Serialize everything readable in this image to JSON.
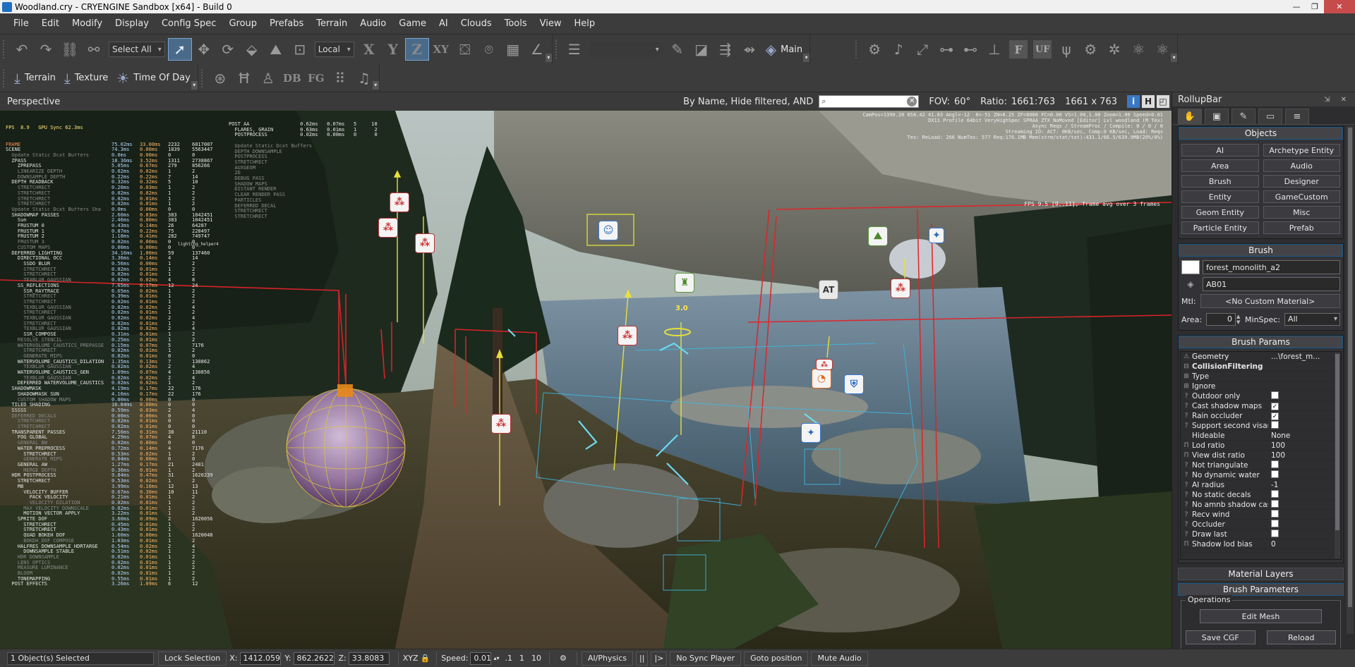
{
  "window": {
    "title": "Woodland.cry - CRYENGINE Sandbox [x64] - Build 0",
    "min_glyph": "—",
    "max_glyph": "❐",
    "close_glyph": "✕"
  },
  "menu": [
    "File",
    "Edit",
    "Modify",
    "Display",
    "Config Spec",
    "Group",
    "Prefabs",
    "Terrain",
    "Audio",
    "Game",
    "AI",
    "Clouds",
    "Tools",
    "View",
    "Help"
  ],
  "toolbar1": {
    "select_filter": "Select All",
    "coord_system": "Local",
    "axis_x": "X",
    "axis_y": "Y",
    "axis_z": "Z",
    "axis_xy": "XY",
    "main_label": "Main",
    "icon_f": "F",
    "icon_uf": "UF"
  },
  "toolbar2": {
    "terrain_label": "Terrain",
    "texture_label": "Texture",
    "time_of_day_label": "Time Of Day",
    "db_label": "DB",
    "fg_label": "FG"
  },
  "viewport": {
    "title": "Perspective",
    "filter_text": "By Name, Hide filtered, AND",
    "search_value": "",
    "fov_label": "FOV:",
    "fov_value": "60°",
    "ratio_label": "Ratio:",
    "ratio_value": "1661:763",
    "resolution": "1661 x 763",
    "btn_info": "i",
    "btn_h": "H"
  },
  "overlay": {
    "top_right_lines": [
      "CamPos=1390.20 858.42 41.83 Angl=-12  0=-51 ZN=0.25 ZF=8000 FC=0.00 VS=1.00,1.00 Zoom=1.00 Speed=0.01",
      "DX11 Profile 64bit VeryHighSpec SPRAA ZTX NoMoved [Editor] Lvl woodland (M Tex)",
      "Async Reqs / StreamProc / Compile: 0 / 0 / 0",
      "Streaming IO: ACT: 0KB/sec, Comp:0 KB/sec, Load: Reqs",
      "Tex: ReLoad: 266 NumTex: 577 Req:176.1MB Mem(strm/stat/tot):431.1/66.5/639.9MB(20%/0%)"
    ],
    "fps_line": "FPS 9.5 [9..11], frame avg over 3 frames",
    "fps_header": "FPS  8.9   GPU Sync 62.3ms",
    "helper_label": "lighting_helper4",
    "sphere_value": "3.0",
    "at_label": "AT"
  },
  "profiler_rows": [
    {
      "name": "FRAME",
      "a": "75.02ms",
      "b": "33.00ms",
      "c": "2232",
      "d": "6017007",
      "cls": "hi"
    },
    {
      "name": "SCENE",
      "a": "74.3ms",
      "b": "0.00ms",
      "c": "1839",
      "d": "5563447",
      "cls": ""
    },
    {
      "name": "  Update Static Dcxt Buffers",
      "a": "0.0ms",
      "b": "0.00ms",
      "c": "0",
      "d": "0",
      "cls": "dim"
    },
    {
      "name": "  ZPASS",
      "a": "18.36ms",
      "b": "3.52ms",
      "c": "1311",
      "d": "2738867",
      "cls": ""
    },
    {
      "name": "    ZPREPASS",
      "a": "5.05ms",
      "b": "0.67ms",
      "c": "279",
      "d": "856266",
      "cls": ""
    },
    {
      "name": "    LINEARIZE DEPTH",
      "a": "0.02ms",
      "b": "0.02ms",
      "c": "1",
      "d": "2",
      "cls": "dim"
    },
    {
      "name": "    DOWNSAMPLE DEPTH",
      "a": "0.22ms",
      "b": "0.22ms",
      "c": "7",
      "d": "14",
      "cls": "dim"
    },
    {
      "name": "  DEPTH READBACK",
      "a": "0.32ms",
      "b": "0.32ms",
      "c": "5",
      "d": "10",
      "cls": ""
    },
    {
      "name": "    STRETCHRECT",
      "a": "0.20ms",
      "b": "0.03ms",
      "c": "1",
      "d": "2",
      "cls": "dim"
    },
    {
      "name": "    STRETCHRECT",
      "a": "0.02ms",
      "b": "0.02ms",
      "c": "1",
      "d": "2",
      "cls": "dim"
    },
    {
      "name": "    STRETCHRECT",
      "a": "0.02ms",
      "b": "0.01ms",
      "c": "1",
      "d": "2",
      "cls": "dim"
    },
    {
      "name": "    STRETCHRECT",
      "a": "0.02ms",
      "b": "0.01ms",
      "c": "1",
      "d": "2",
      "cls": "dim"
    },
    {
      "name": "  Update Static Dcxt Buffers Sha",
      "a": "0.0ms",
      "b": "0.00ms",
      "c": "0",
      "d": "0",
      "cls": "dim"
    },
    {
      "name": "  SHADOWMAP PASSES",
      "a": "2.60ms",
      "b": "0.83ms",
      "c": "383",
      "d": "1042451",
      "cls": ""
    },
    {
      "name": "    Sun",
      "a": "2.46ms",
      "b": "0.80ms",
      "c": "383",
      "d": "1042451",
      "cls": ""
    },
    {
      "name": "    FRUSTUM 0",
      "a": "0.43ms",
      "b": "0.14ms",
      "c": "26",
      "d": "64287",
      "cls": ""
    },
    {
      "name": "    FRUSTUM 1",
      "a": "0.87ms",
      "b": "0.22ms",
      "c": "75",
      "d": "228497",
      "cls": ""
    },
    {
      "name": "    FRUSTUM 2",
      "a": "1.18ms",
      "b": "0.41ms",
      "c": "282",
      "d": "749747",
      "cls": ""
    },
    {
      "name": "    FRUSTUM 3",
      "a": "0.02ms",
      "b": "0.00ms",
      "c": "0",
      "d": "0",
      "cls": "dim"
    },
    {
      "name": "    CUSTOM MAPS",
      "a": "0.00ms",
      "b": "0.00ms",
      "c": "0",
      "d": "0",
      "cls": "dim"
    },
    {
      "name": "  DEFERRED LIGHTING",
      "a": "34.16ms",
      "b": "1.00ms",
      "c": "59",
      "d": "137460",
      "cls": ""
    },
    {
      "name": "    DIRECTIONAL OCC",
      "a": "3.36ms",
      "b": "0.14ms",
      "c": "4",
      "d": "14",
      "cls": ""
    },
    {
      "name": "      SSDO BLUR",
      "a": "0.56ms",
      "b": "0.00ms",
      "c": "1",
      "d": "2",
      "cls": ""
    },
    {
      "name": "      STRETCHRECT",
      "a": "0.02ms",
      "b": "0.01ms",
      "c": "1",
      "d": "2",
      "cls": "dim"
    },
    {
      "name": "      STRETCHRECT",
      "a": "0.02ms",
      "b": "0.01ms",
      "c": "1",
      "d": "2",
      "cls": "dim"
    },
    {
      "name": "      TEXBLUR GAUSSIAN",
      "a": "0.02ms",
      "b": "0.02ms",
      "c": "4",
      "d": "8",
      "cls": "dim"
    },
    {
      "name": "    SS_REFLECTIONS",
      "a": "7.65ms",
      "b": "0.17ms",
      "c": "12",
      "d": "24",
      "cls": ""
    },
    {
      "name": "      SSR_RAYTRACE",
      "a": "6.65ms",
      "b": "0.02ms",
      "c": "1",
      "d": "2",
      "cls": ""
    },
    {
      "name": "      STRETCHRECT",
      "a": "0.39ms",
      "b": "0.01ms",
      "c": "1",
      "d": "2",
      "cls": "dim"
    },
    {
      "name": "      STRETCHRECT",
      "a": "0.02ms",
      "b": "0.01ms",
      "c": "1",
      "d": "2",
      "cls": "dim"
    },
    {
      "name": "      TEXBLUR GAUSSIAN",
      "a": "0.02ms",
      "b": "0.02ms",
      "c": "2",
      "d": "4",
      "cls": "dim"
    },
    {
      "name": "      STRETCHRECT",
      "a": "0.02ms",
      "b": "0.01ms",
      "c": "1",
      "d": "2",
      "cls": "dim"
    },
    {
      "name": "      TEXBLUR GAUSSIAN",
      "a": "0.02ms",
      "b": "0.02ms",
      "c": "2",
      "d": "4",
      "cls": "dim"
    },
    {
      "name": "      STRETCHRECT",
      "a": "0.02ms",
      "b": "0.01ms",
      "c": "1",
      "d": "2",
      "cls": "dim"
    },
    {
      "name": "      TEXBLUR GAUSSIAN",
      "a": "0.02ms",
      "b": "0.02ms",
      "c": "2",
      "d": "4",
      "cls": "dim"
    },
    {
      "name": "      SSR_COMPOSE",
      "a": "0.31ms",
      "b": "0.01ms",
      "c": "1",
      "d": "2",
      "cls": ""
    },
    {
      "name": "    RESOLVE STENCIL",
      "a": "0.25ms",
      "b": "0.01ms",
      "c": "1",
      "d": "2",
      "cls": "dim"
    },
    {
      "name": "    WATERVOLUME_CAUSTICS_PREPASSE",
      "a": "0.15ms",
      "b": "0.07ms",
      "c": "5",
      "d": "7176",
      "cls": "dim"
    },
    {
      "name": "      STRETCHRECT",
      "a": "0.02ms",
      "b": "0.01ms",
      "c": "1",
      "d": "2",
      "cls": "dim"
    },
    {
      "name": "      GENERATE MIPS",
      "a": "0.02ms",
      "b": "0.01ms",
      "c": "0",
      "d": "0",
      "cls": "dim"
    },
    {
      "name": "    WATERVOLUME_CAUSTICS_DILATION",
      "a": "1.35ms",
      "b": "0.13ms",
      "c": "7",
      "d": "130862",
      "cls": ""
    },
    {
      "name": "      TEXBLUR GAUSSIAN",
      "a": "0.02ms",
      "b": "0.02ms",
      "c": "2",
      "d": "4",
      "cls": "dim"
    },
    {
      "name": "    WATERVOLUME_CAUSTICS_GEN",
      "a": "1.09ms",
      "b": "0.07ms",
      "c": "4",
      "d": "130856",
      "cls": ""
    },
    {
      "name": "      TEXBLUR GAUSSIAN",
      "a": "0.02ms",
      "b": "0.02ms",
      "c": "2",
      "d": "4",
      "cls": "dim"
    },
    {
      "name": "    DEFERRED WATERVOLUME_CAUSTICS",
      "a": "0.02ms",
      "b": "0.02ms",
      "c": "1",
      "d": "2",
      "cls": ""
    },
    {
      "name": "  SHADOWMASK",
      "a": "4.19ms",
      "b": "0.17ms",
      "c": "22",
      "d": "176",
      "cls": ""
    },
    {
      "name": "    SHADOWMASK SUN",
      "a": "4.16ms",
      "b": "0.17ms",
      "c": "22",
      "d": "176",
      "cls": ""
    },
    {
      "name": "    CUSTOM SHADOW MAPS",
      "a": "0.00ms",
      "b": "0.00ms",
      "c": "0",
      "d": "0",
      "cls": "dim"
    },
    {
      "name": "  TILED SHADING",
      "a": "16.84ms",
      "b": "0.00ms",
      "c": "0",
      "d": "0",
      "cls": ""
    },
    {
      "name": "  SSSSS",
      "a": "0.59ms",
      "b": "0.03ms",
      "c": "2",
      "d": "4",
      "cls": ""
    },
    {
      "name": "  DEFERRED DECALS",
      "a": "0.00ms",
      "b": "0.00ms",
      "c": "0",
      "d": "0",
      "cls": "dim"
    },
    {
      "name": "    STRETCHRECT",
      "a": "0.02ms",
      "b": "0.01ms",
      "c": "0",
      "d": "0",
      "cls": "dim"
    },
    {
      "name": "    STRETCHRECT",
      "a": "0.02ms",
      "b": "0.01ms",
      "c": "0",
      "d": "0",
      "cls": "dim"
    },
    {
      "name": "  TRANSPARENT PASSES",
      "a": "7.56ms",
      "b": "0.31ms",
      "c": "38",
      "d": "21110",
      "cls": ""
    },
    {
      "name": "    FOG GLOBAL",
      "a": "4.29ms",
      "b": "0.07ms",
      "c": "4",
      "d": "8",
      "cls": ""
    },
    {
      "name": "    GENERAL BW",
      "a": "0.02ms",
      "b": "0.00ms",
      "c": "0",
      "d": "0",
      "cls": "dim"
    },
    {
      "name": "    WATER PREPROCESS",
      "a": "0.72ms",
      "b": "0.14ms",
      "c": "4",
      "d": "7176",
      "cls": ""
    },
    {
      "name": "      STRETCHRECT",
      "a": "0.53ms",
      "b": "0.02ms",
      "c": "1",
      "d": "2",
      "cls": ""
    },
    {
      "name": "      GENERATE MIPS",
      "a": "0.04ms",
      "b": "0.00ms",
      "c": "0",
      "d": "0",
      "cls": "dim"
    },
    {
      "name": "    GENERAL AW",
      "a": "1.27ms",
      "b": "0.17ms",
      "c": "21",
      "d": "2401",
      "cls": ""
    },
    {
      "name": "      MERGE DEPTH",
      "a": "0.36ms",
      "b": "0.01ms",
      "c": "1",
      "d": "2",
      "cls": "dim"
    },
    {
      "name": "  HDR POSTPROCESS",
      "a": "9.84ms",
      "b": "0.47ms",
      "c": "31",
      "d": "1620239",
      "cls": ""
    },
    {
      "name": "    STRETCHRECT",
      "a": "0.53ms",
      "b": "0.02ms",
      "c": "1",
      "d": "2",
      "cls": ""
    },
    {
      "name": "    MB",
      "a": "3.99ms",
      "b": "0.16ms",
      "c": "12",
      "d": "13",
      "cls": ""
    },
    {
      "name": "      VELOCITY BUFFER",
      "a": "0.67ms",
      "b": "0.30ms",
      "c": "10",
      "d": "11",
      "cls": ""
    },
    {
      "name": "        PACK VELOCITY",
      "a": "0.21ms",
      "b": "0.01ms",
      "c": "1",
      "d": "2",
      "cls": ""
    },
    {
      "name": "        VELOCITY DILATION",
      "a": "0.02ms",
      "b": "0.01ms",
      "c": "1",
      "d": "2",
      "cls": "dim"
    },
    {
      "name": "      MAX VELOCITY DOWNSCALE",
      "a": "0.02ms",
      "b": "0.01ms",
      "c": "1",
      "d": "2",
      "cls": "dim"
    },
    {
      "name": "      MOTION VECTOR APPLY",
      "a": "3.22ms",
      "b": "0.01ms",
      "c": "1",
      "d": "2",
      "cls": ""
    },
    {
      "name": "    SPRITE DOF",
      "a": "3.60ms",
      "b": "0.09ms",
      "c": "2",
      "d": "1620056",
      "cls": ""
    },
    {
      "name": "      STRETCHRECT",
      "a": "0.45ms",
      "b": "0.01ms",
      "c": "1",
      "d": "2",
      "cls": ""
    },
    {
      "name": "      STRETCHRECT",
      "a": "0.43ms",
      "b": "0.01ms",
      "c": "1",
      "d": "2",
      "cls": ""
    },
    {
      "name": "      QUAD BOKEH DOF",
      "a": "1.60ms",
      "b": "0.00ms",
      "c": "1",
      "d": "1620048",
      "cls": ""
    },
    {
      "name": "      BOKEH_DOF COMPOSE",
      "a": "1.03ms",
      "b": "0.01ms",
      "c": "1",
      "d": "2",
      "cls": "dim"
    },
    {
      "name": "    HALFRES DOWNSAMPLE HDRTARGE",
      "a": "0.54ms",
      "b": "0.02ms",
      "c": "2",
      "d": "4",
      "cls": ""
    },
    {
      "name": "      DOWNSAMPLE STABLE",
      "a": "0.51ms",
      "b": "0.02ms",
      "c": "1",
      "d": "2",
      "cls": ""
    },
    {
      "name": "    HDR DOWNSAMPLE",
      "a": "0.02ms",
      "b": "0.01ms",
      "c": "1",
      "d": "2",
      "cls": "dim"
    },
    {
      "name": "    LENS OPTICS",
      "a": "0.02ms",
      "b": "0.01ms",
      "c": "1",
      "d": "2",
      "cls": "dim"
    },
    {
      "name": "    MEASURE LUMINANCE",
      "a": "0.02ms",
      "b": "0.01ms",
      "c": "1",
      "d": "2",
      "cls": "dim"
    },
    {
      "name": "    BLOOM",
      "a": "0.02ms",
      "b": "0.01ms",
      "c": "1",
      "d": "2",
      "cls": "dim"
    },
    {
      "name": "    TONEMAPPING",
      "a": "0.55ms",
      "b": "0.01ms",
      "c": "1",
      "d": "2",
      "cls": ""
    },
    {
      "name": "  POST EFFECTS",
      "a": "3.26ms",
      "b": "1.09ms",
      "c": "6",
      "d": "12",
      "cls": ""
    }
  ],
  "profiler2_lines": [
    "POST AA                 0.62ms   0.07ms   5     10",
    "  FLARES, GRAIN         0.63ms   0.01ms   1      2",
    "  POSTPROCESS           0.02ms   0.00ms   0      0",
    "",
    "  Update Static Dcxt Buffers",
    "  DEPTH DOWNSAMPLE",
    "  POSTPROCESS",
    "  STRETCHRECT",
    "  AUXGEOM",
    "  2D",
    "  DEBUG PASS",
    "  SHADOW MAPS",
    "  DISTANT RENDER",
    "  CLEAR RENDER PASS",
    "  PARTICLES",
    "  DEFERRED DECAL",
    "  STRETCHRECT",
    "  STRETCHRECT"
  ],
  "rollup": {
    "title": "RollupBar",
    "ctrl_glyphs": "⇲ ✕",
    "tab_icons": [
      "✋",
      "▣",
      "✎",
      "▭",
      "≡"
    ],
    "objects_header": "Objects",
    "object_buttons": [
      "AI",
      "Archetype Entity",
      "Area",
      "Audio",
      "Brush",
      "Designer",
      "Entity",
      "GameCustom",
      "Geom Entity",
      "Misc",
      "Particle Entity",
      "Prefab"
    ],
    "brush_header": "Brush",
    "brush_name": "forest_monolith_a2",
    "layer_name": "AB01",
    "mtl_label": "Mtl:",
    "mtl_value": "<No Custom Material>",
    "area_label": "Area:",
    "area_value": "0",
    "minspec_label": "MinSpec:",
    "minspec_value": "All",
    "brush_params_header": "Brush Params",
    "params": [
      {
        "icon": "⚠",
        "name": "Geometry",
        "value": "...\\forest_m...",
        "kind": "header"
      },
      {
        "icon": "⊟",
        "name": "CollisionFiltering",
        "value": "",
        "kind": "group"
      },
      {
        "icon": "⊞",
        "name": "Type",
        "value": "",
        "kind": "plain"
      },
      {
        "icon": "⊞",
        "name": "Ignore",
        "value": "",
        "kind": "plain"
      },
      {
        "icon": "?",
        "name": "Outdoor only",
        "value": "",
        "kind": "check",
        "checked": false
      },
      {
        "icon": "?",
        "name": "Cast shadow maps",
        "value": "",
        "kind": "check",
        "checked": true
      },
      {
        "icon": "?",
        "name": "Rain occluder",
        "value": "",
        "kind": "check",
        "checked": true
      },
      {
        "icon": "?",
        "name": "Support second visarea",
        "value": "",
        "kind": "check",
        "checked": false
      },
      {
        "icon": "",
        "name": "Hideable",
        "value": "None",
        "kind": "plain"
      },
      {
        "icon": "Π",
        "name": "Lod ratio",
        "value": "100",
        "kind": "plain"
      },
      {
        "icon": "Π",
        "name": "View dist ratio",
        "value": "100",
        "kind": "plain"
      },
      {
        "icon": "?",
        "name": "Not triangulate",
        "value": "",
        "kind": "check",
        "checked": false
      },
      {
        "icon": "?",
        "name": "No dynamic water",
        "value": "",
        "kind": "check",
        "checked": false
      },
      {
        "icon": "?",
        "name": "AI radius",
        "value": "-1",
        "kind": "plain"
      },
      {
        "icon": "?",
        "name": "No static decals",
        "value": "",
        "kind": "check",
        "checked": false
      },
      {
        "icon": "?",
        "name": "No amnb shadow caster",
        "value": "",
        "kind": "check",
        "checked": false
      },
      {
        "icon": "?",
        "name": "Recv wind",
        "value": "",
        "kind": "check",
        "checked": false
      },
      {
        "icon": "?",
        "name": "Occluder",
        "value": "",
        "kind": "check",
        "checked": false
      },
      {
        "icon": "?",
        "name": "Draw last",
        "value": "",
        "kind": "check",
        "checked": false
      },
      {
        "icon": "Π",
        "name": "Shadow lod bias",
        "value": "0",
        "kind": "plain"
      }
    ],
    "material_layers_header": "Material Layers",
    "brush_parameters_header": "Brush Parameters",
    "operations_legend": "Operations",
    "edit_mesh_label": "Edit Mesh",
    "save_cgf_label": "Save CGF",
    "reload_label": "Reload"
  },
  "statusbar": {
    "selection": "1 Object(s) Selected",
    "lock_selection": "Lock Selection",
    "x_label": "X:",
    "x_value": "1412.059",
    "y_label": "Y:",
    "y_value": "862.2622",
    "z_label": "Z:",
    "z_value": "33.8083",
    "xyz_label": "XYZ",
    "speed_label": "Speed:",
    "speed_value": "0.01",
    "speed_opt1": ".1",
    "speed_opt2": "1",
    "speed_opt3": "10",
    "ai_physics": "AI/Physics",
    "pause_glyph": "||",
    "step_glyph": "|>",
    "no_sync_player": "No Sync Player",
    "goto_position": "Goto position",
    "mute_audio": "Mute Audio"
  }
}
